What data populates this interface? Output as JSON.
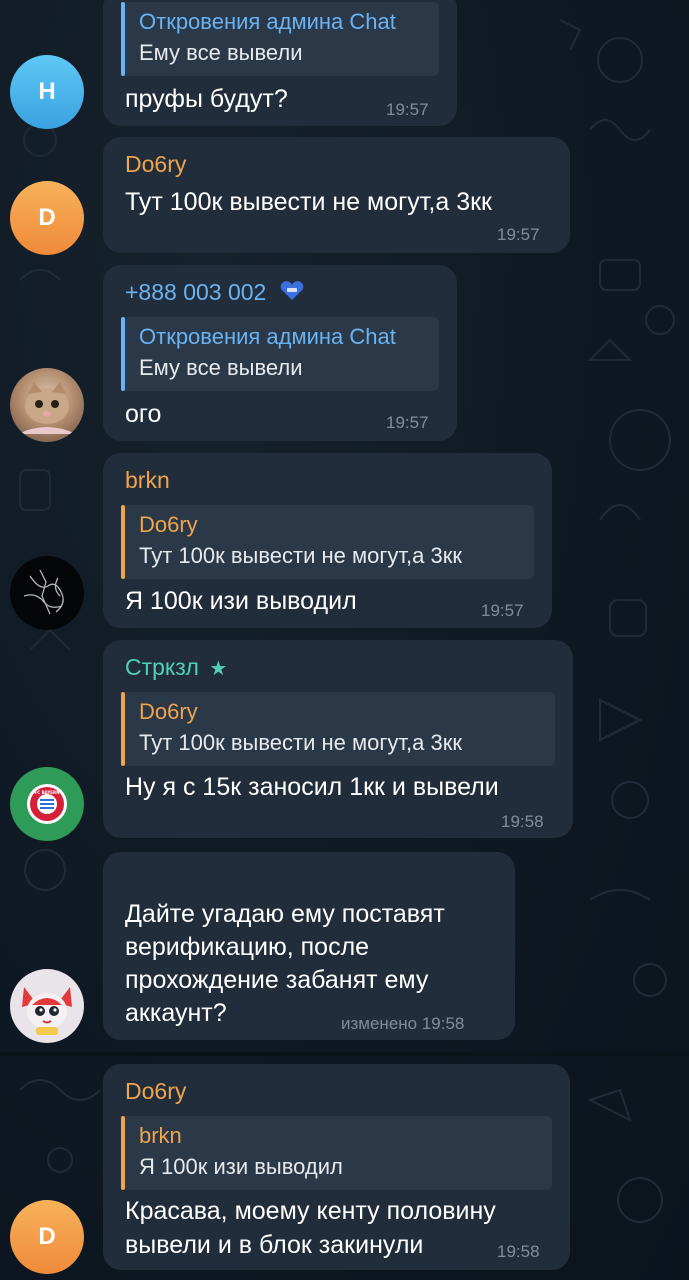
{
  "messages": [
    {
      "reply_name": "Откровения админа Chat",
      "reply_text": "Ему все вывели",
      "text": "пруфы будут?",
      "time": "19:57"
    },
    {
      "name": "Do6ry",
      "text": "Тут 100к вывести не могут,а 3кк",
      "time": "19:57"
    },
    {
      "name": "+888 003 002",
      "reply_name": "Откровения админа Chat",
      "reply_text": "Ему все вывели",
      "text": "ого",
      "time": "19:57"
    },
    {
      "name": "brkn",
      "reply_name": "Do6ry",
      "reply_text": "Тут 100к вывести не могут,а 3кк",
      "text": "Я 100к изи выводил",
      "time": "19:57"
    },
    {
      "name": "Стркзл",
      "reply_name": "Do6ry",
      "reply_text": "Тут 100к вывести не могут,а 3кк",
      "text": "Ну я с 15к заносил 1кк и вывели",
      "time": "19:58"
    },
    {
      "text_lines": [
        "Дайте угадаю ему поставят",
        "верификацию, после",
        "прохождение забанят ему",
        "аккаунт?"
      ],
      "time": "изменено 19:58"
    },
    {
      "name": "Do6ry",
      "reply_name": "brkn",
      "reply_text": "Я 100к изи выводил",
      "text_lines": [
        "Красава, моему кенту половину",
        "вывели и в блок закинули"
      ],
      "time": "19:58"
    }
  ],
  "avatars": {
    "h_letter": "H",
    "d_letter": "D",
    "d2_letter": "D"
  },
  "colors": {
    "bubble": "#212d3a",
    "background": "#0f1a24",
    "accent_blue": "#6ab3f3",
    "name_orange": "#f0a44c",
    "name_teal": "#4fd1b6"
  }
}
